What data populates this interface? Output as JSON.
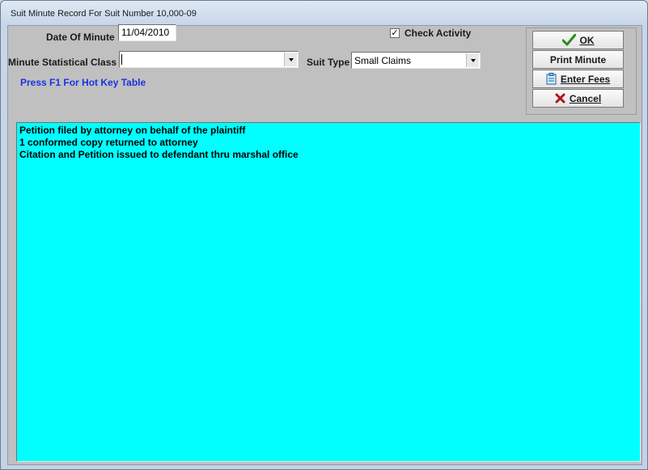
{
  "window": {
    "title": "Suit Minute Record For Suit Number 10,000-09"
  },
  "form": {
    "date_label": "Date Of Minute :",
    "date_value": "11/04/2010",
    "stat_class_label": "Minute Statistical Class",
    "stat_class_value": "",
    "suit_type_label": "Suit Type",
    "suit_type_value": "Small Claims",
    "check_activity_label": "Check Activity",
    "check_activity_checked": true,
    "check_mark": "✓",
    "hotkey_hint": "Press F1 For Hot Key Table"
  },
  "buttons": {
    "ok": "OK",
    "print": "Print Minute",
    "fees": "Enter Fees",
    "cancel": "Cancel"
  },
  "memo": {
    "lines": [
      "Petition filed by attorney on behalf of the plaintiff",
      "1 conformed copy returned to attorney",
      "Citation and Petition issued to defendant thru marshal office"
    ]
  },
  "colors": {
    "memo_background": "#00ffff",
    "hotkey_text": "#1a32e0",
    "ok_icon": "#2a8a1f",
    "cancel_icon": "#b01515",
    "client_background": "#c0c0c0"
  }
}
